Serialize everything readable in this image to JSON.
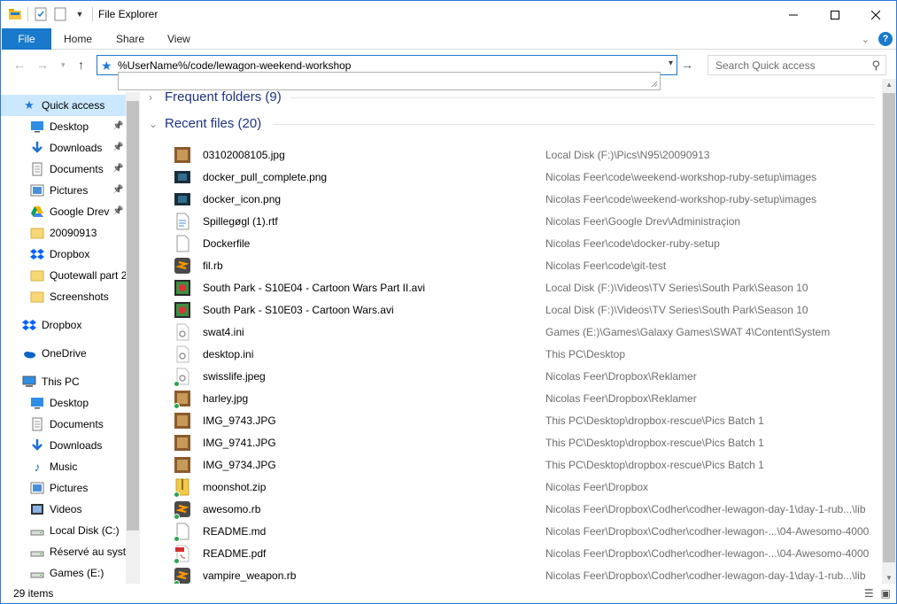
{
  "window": {
    "title": "File Explorer"
  },
  "ribbon": {
    "tabs": [
      "File",
      "Home",
      "Share",
      "View"
    ]
  },
  "address": {
    "value": "%UserName%/code/lewagon-weekend-workshop"
  },
  "search": {
    "placeholder": "Search Quick access"
  },
  "nav": {
    "items": [
      {
        "label": "Quick access",
        "icon": "star-icon",
        "pinned": false
      },
      {
        "label": "Desktop",
        "icon": "desktop-icon",
        "pinned": true
      },
      {
        "label": "Downloads",
        "icon": "download-icon",
        "pinned": true
      },
      {
        "label": "Documents",
        "icon": "documents-icon",
        "pinned": true
      },
      {
        "label": "Pictures",
        "icon": "pictures-icon",
        "pinned": true
      },
      {
        "label": "Google Drev",
        "icon": "google-drive-icon",
        "pinned": true
      },
      {
        "label": "20090913",
        "icon": "folder-icon",
        "pinned": false
      },
      {
        "label": "Dropbox",
        "icon": "dropbox-icon",
        "pinned": false
      },
      {
        "label": "Quotewall part 2",
        "icon": "folder-icon",
        "pinned": false
      },
      {
        "label": "Screenshots",
        "icon": "folder-icon",
        "pinned": false
      },
      {
        "label": "Dropbox",
        "icon": "dropbox-icon",
        "pinned": false
      },
      {
        "label": "OneDrive",
        "icon": "onedrive-icon",
        "pinned": false
      },
      {
        "label": "This PC",
        "icon": "computer-icon",
        "pinned": false
      },
      {
        "label": "Desktop",
        "icon": "desktop-icon",
        "pinned": false
      },
      {
        "label": "Documents",
        "icon": "documents-icon",
        "pinned": false
      },
      {
        "label": "Downloads",
        "icon": "download-icon",
        "pinned": false
      },
      {
        "label": "Music",
        "icon": "music-icon",
        "pinned": false
      },
      {
        "label": "Pictures",
        "icon": "pictures-icon",
        "pinned": false
      },
      {
        "label": "Videos",
        "icon": "videos-icon",
        "pinned": false
      },
      {
        "label": "Local Disk (C:)",
        "icon": "drive-icon",
        "pinned": false
      },
      {
        "label": "Réservé au systè",
        "icon": "drive-icon",
        "pinned": false
      },
      {
        "label": "Games (E:)",
        "icon": "drive-icon",
        "pinned": false
      }
    ]
  },
  "groups": {
    "frequent": "Frequent folders (9)",
    "recent": "Recent files (20)"
  },
  "files": [
    {
      "name": "03102008105.jpg",
      "location": "Local Disk (F:)\\Pics\\N95\\20090913",
      "icon": "photo-icon",
      "synced": false
    },
    {
      "name": "docker_pull_complete.png",
      "location": "Nicolas Feer\\code\\weekend-workshop-ruby-setup\\images",
      "icon": "image-icon",
      "synced": false
    },
    {
      "name": "docker_icon.png",
      "location": "Nicolas Feer\\code\\weekend-workshop-ruby-setup\\images",
      "icon": "image-icon",
      "synced": false
    },
    {
      "name": "Spillegøgl (1).rtf",
      "location": "Nicolas Feer\\Google Drev\\Administraçion",
      "icon": "rtf-icon",
      "synced": false
    },
    {
      "name": "Dockerfile",
      "location": "Nicolas Feer\\code\\docker-ruby-setup",
      "icon": "blank-file-icon",
      "synced": false
    },
    {
      "name": "fil.rb",
      "location": "Nicolas Feer\\code\\git-test",
      "icon": "sublime-icon",
      "synced": false
    },
    {
      "name": "South Park - S10E04 - Cartoon Wars Part II.avi",
      "location": "Local Disk (F:)\\Videos\\TV Series\\South Park\\Season 10",
      "icon": "video-file-icon",
      "synced": false
    },
    {
      "name": "South Park - S10E03 - Cartoon Wars.avi",
      "location": "Local Disk (F:)\\Videos\\TV Series\\South Park\\Season 10",
      "icon": "video-file-icon",
      "synced": false
    },
    {
      "name": "swat4.ini",
      "location": "Games (E:)\\Games\\Galaxy Games\\SWAT 4\\Content\\System",
      "icon": "settings-file-icon",
      "synced": false
    },
    {
      "name": "desktop.ini",
      "location": "This PC\\Desktop",
      "icon": "settings-file-icon",
      "synced": false
    },
    {
      "name": "swisslife.jpeg",
      "location": "Nicolas Feer\\Dropbox\\Reklamer",
      "icon": "settings-file-icon",
      "synced": true
    },
    {
      "name": "harley.jpg",
      "location": "Nicolas Feer\\Dropbox\\Reklamer",
      "icon": "photo-icon",
      "synced": true
    },
    {
      "name": "IMG_9743.JPG",
      "location": "This PC\\Desktop\\dropbox-rescue\\Pics Batch 1",
      "icon": "photo-icon",
      "synced": false
    },
    {
      "name": "IMG_9741.JPG",
      "location": "This PC\\Desktop\\dropbox-rescue\\Pics Batch 1",
      "icon": "photo-icon",
      "synced": false
    },
    {
      "name": "IMG_9734.JPG",
      "location": "This PC\\Desktop\\dropbox-rescue\\Pics Batch 1",
      "icon": "photo-icon",
      "synced": false
    },
    {
      "name": "moonshot.zip",
      "location": "Nicolas Feer\\Dropbox",
      "icon": "zip-icon",
      "synced": true
    },
    {
      "name": "awesomo.rb",
      "location": "Nicolas Feer\\Dropbox\\Codher\\codher-lewagon-day-1\\day-1-rub...\\lib",
      "icon": "sublime-icon",
      "synced": true
    },
    {
      "name": "README.md",
      "location": "Nicolas Feer\\Dropbox\\Codher\\codher-lewagon-...\\04-Awesomo-4000",
      "icon": "blank-file-icon",
      "synced": true
    },
    {
      "name": "README.pdf",
      "location": "Nicolas Feer\\Dropbox\\Codher\\codher-lewagon-...\\04-Awesomo-4000",
      "icon": "pdf-icon",
      "synced": true
    },
    {
      "name": "vampire_weapon.rb",
      "location": "Nicolas Feer\\Dropbox\\Codher\\codher-lewagon-day-1\\day-1-rub...\\lib",
      "icon": "sublime-icon",
      "synced": true
    }
  ],
  "status": {
    "count": "29 items"
  },
  "colors": {
    "accent": "#1979ca",
    "selected": "#cce8ff",
    "group_header": "#1e3287",
    "location_text": "#6d6d6d"
  }
}
